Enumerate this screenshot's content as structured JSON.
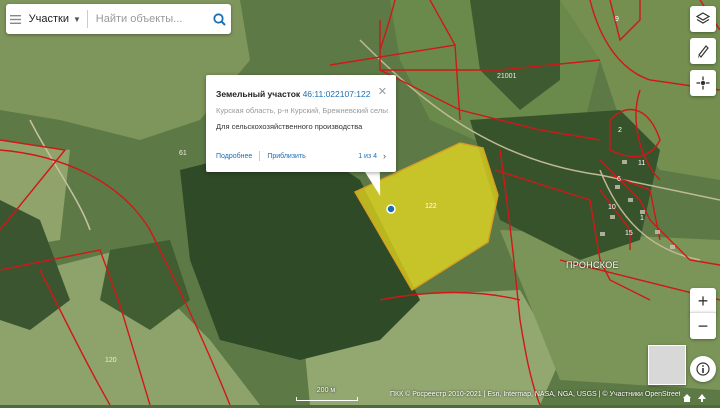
{
  "search": {
    "category": "Участки",
    "placeholder": "Найти объекты..."
  },
  "popup": {
    "type_label": "Земельный участок",
    "cadastral_number": "46:11:022107:122",
    "address": "Курская область, р-н Курский, Брежневский сельсов...",
    "purpose": "Для сельскохозяйственного производства",
    "details_link": "Подробнее",
    "zoom_link": "Приблизить",
    "pager": "1 из 4"
  },
  "map": {
    "parcel_labels": [
      "61",
      "120",
      "122",
      "21001",
      "9",
      "2",
      "6",
      "11",
      "10",
      "15",
      "1"
    ],
    "settlement": "ПРОНСКОЕ",
    "scale": "200 м",
    "attribution": "ПКК © Росреестр 2010-2021 | Esri, Intermap, NASA, NGA, USGS | © Участники OpenStreetMap | Maxar"
  },
  "controls": {
    "zoom_in": "+",
    "zoom_out": "−",
    "icons": [
      "layers-icon",
      "ruler-icon",
      "locate-icon",
      "info-icon",
      "home-icon",
      "up-arrow-icon"
    ]
  },
  "colors": {
    "boundary": "#d01818",
    "selected_fill": "#f0e11f",
    "selected_stroke": "#d8a020",
    "accent": "#1a6fb3"
  }
}
